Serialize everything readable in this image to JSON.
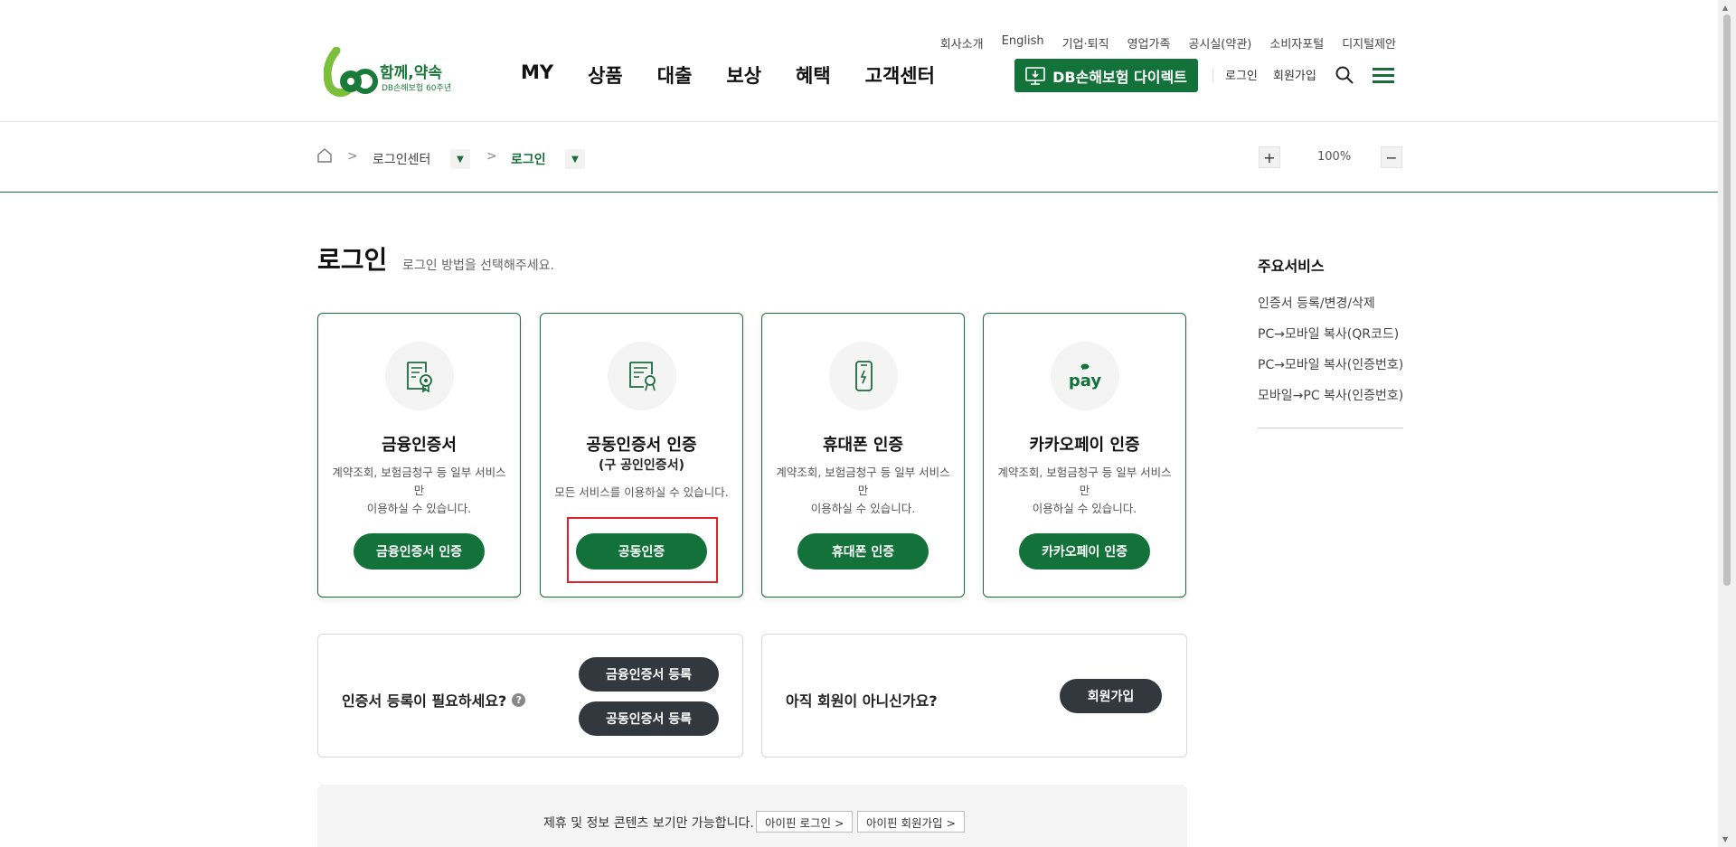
{
  "header": {
    "util_links": [
      "회사소개",
      "English",
      "기업·퇴직",
      "영업가족",
      "공시실(약관)",
      "소비자포털",
      "디지털제안"
    ],
    "logo_text": "함께,약속",
    "logo_sub": "DB손해보험 60주년",
    "gnb": [
      "MY",
      "상품",
      "대출",
      "보상",
      "혜택",
      "고객센터"
    ],
    "direct_button": "DB손해보험 다이렉트",
    "login": "로그인",
    "join": "회원가입"
  },
  "breadcrumb": {
    "items": [
      "로그인센터",
      "로그인"
    ],
    "dropdown_icon": "▼",
    "separator": ">"
  },
  "zoom": {
    "plus": "+",
    "value": "100%",
    "minus": "−"
  },
  "page": {
    "title": "로그인",
    "subtitle": "로그인 방법을 선택해주세요."
  },
  "cards": [
    {
      "icon": "financial-certificate-icon",
      "title": "금융인증서",
      "title2": "",
      "desc_line1": "계약조회, 보험금청구 등 일부 서비스만",
      "desc_line2": "이용하실 수 있습니다.",
      "button": "금융인증서 인증"
    },
    {
      "icon": "joint-certificate-icon",
      "title": "공동인증서 인증",
      "title2": "(구 공인인증서)",
      "desc_line1": "모든 서비스를 이용하실 수 있습니다.",
      "desc_line2": "",
      "button": "공동인증"
    },
    {
      "icon": "mobile-phone-icon",
      "title": "휴대폰 인증",
      "title2": "",
      "desc_line1": "계약조회, 보험금청구 등 일부 서비스만",
      "desc_line2": "이용하실 수 있습니다.",
      "button": "휴대폰 인증"
    },
    {
      "icon": "kakaopay-icon",
      "icon_text": "pay",
      "title": "카카오페이 인증",
      "title2": "",
      "desc_line1": "계약조회, 보험금청구 등 일부 서비스만",
      "desc_line2": "이용하실 수 있습니다.",
      "button": "카카오페이 인증"
    }
  ],
  "cert_box": {
    "label": "인증서 등록이 필요하세요?",
    "help": "?",
    "buttons": [
      "금융인증서 등록",
      "공동인증서 등록"
    ]
  },
  "join_box": {
    "label": "아직 회원이 아니신가요?",
    "button": "회원가입"
  },
  "ipin": {
    "text": "제휴 및 정보 콘텐츠 보기만 가능합니다.",
    "login": "아이핀 로그인 >",
    "join": "아이핀 회원가입 >"
  },
  "side": {
    "title": "주요서비스",
    "items": [
      "인증서 등록/변경/삭제",
      "PC→모바일 복사(QR코드)",
      "PC→모바일 복사(인증번호)",
      "모바일→PC 복사(인증번호)"
    ]
  },
  "colors": {
    "brand_green": "#12723a",
    "dark_button": "#33383f",
    "highlight_red": "#e0202a"
  }
}
